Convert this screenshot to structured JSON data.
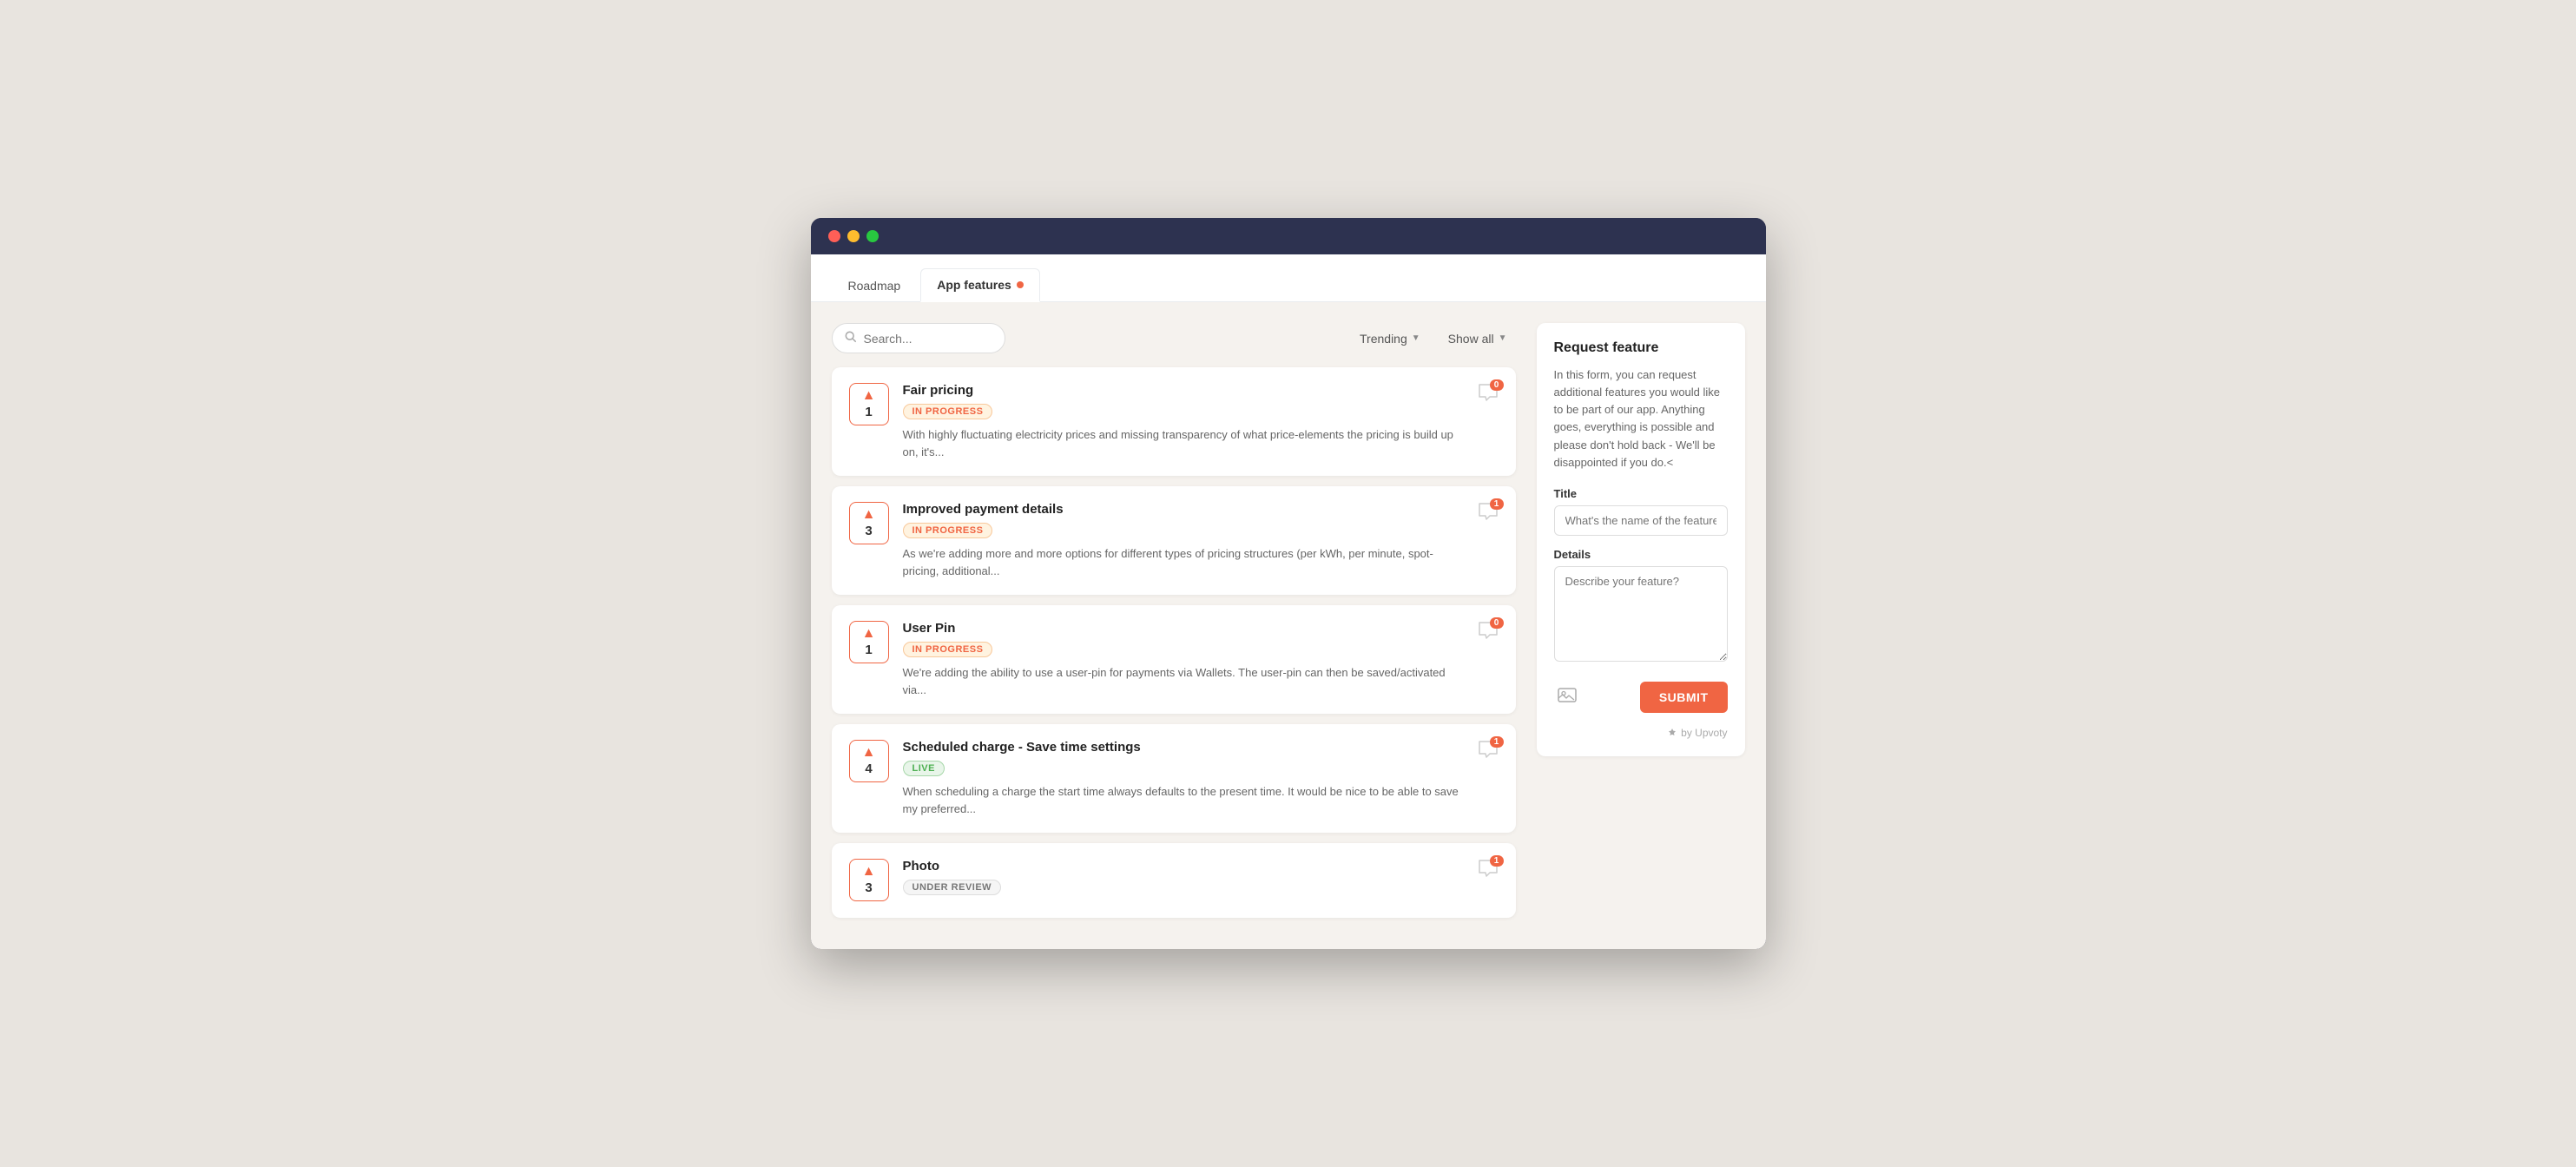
{
  "browser": {
    "traffic_lights": [
      "red",
      "yellow",
      "green"
    ]
  },
  "nav": {
    "tabs": [
      {
        "id": "roadmap",
        "label": "Roadmap",
        "active": false
      },
      {
        "id": "app-features",
        "label": "App features",
        "active": true,
        "has_dot": true
      }
    ]
  },
  "filter_bar": {
    "search_placeholder": "Search...",
    "trending_label": "Trending",
    "show_all_label": "Show all"
  },
  "features": [
    {
      "id": "fair-pricing",
      "title": "Fair pricing",
      "status": "IN PROGRESS",
      "status_type": "in-progress",
      "votes": 1,
      "description": "With highly fluctuating electricity prices and missing transparency of what price-elements the pricing is build up on, it's...",
      "comments": 0
    },
    {
      "id": "improved-payment",
      "title": "Improved payment details",
      "status": "IN PROGRESS",
      "status_type": "in-progress",
      "votes": 3,
      "description": "As we're adding more and more options for different types of pricing structures (per kWh, per minute, spot-pricing, additional...",
      "comments": 1
    },
    {
      "id": "user-pin",
      "title": "User Pin",
      "status": "IN PROGRESS",
      "status_type": "in-progress",
      "votes": 1,
      "description": "We're adding the ability to use a user-pin for payments via Wallets. The user-pin can then be saved/activated via...",
      "comments": 0
    },
    {
      "id": "scheduled-charge",
      "title": "Scheduled charge - Save time settings",
      "status": "LIVE",
      "status_type": "live",
      "votes": 4,
      "description": "When scheduling a charge the start time always defaults to the present time. It would be nice to be able to save my preferred...",
      "comments": 1
    },
    {
      "id": "photo",
      "title": "Photo",
      "status": "UNDER REVIEW",
      "status_type": "under-review",
      "votes": 3,
      "description": "",
      "comments": 1
    }
  ],
  "request_feature": {
    "title": "Request feature",
    "description": "In this form, you can request additional features you would like to be part of our app. Anything goes, everything is possible and please don't hold back - We'll be disappointed if you do.<",
    "title_label": "Title",
    "title_placeholder": "What's the name of the feature?",
    "details_label": "Details",
    "details_placeholder": "Describe your feature?",
    "submit_label": "SUBMIT",
    "credit_text": "by Upvoty"
  }
}
